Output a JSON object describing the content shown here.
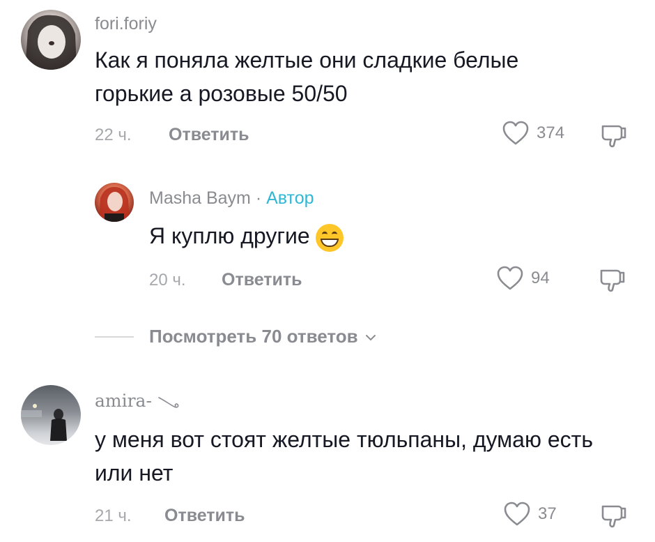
{
  "comments": [
    {
      "username": "fori.foriy",
      "text": "Как я поняла желтые они сладкие белые горькие а розовые 50/50",
      "time": "22 ч.",
      "reply_label": "Ответить",
      "likes": "374"
    },
    {
      "username": "Masha Baym",
      "separator": "·",
      "author_badge": "Автор",
      "text": "Я куплю другие",
      "emoji": "grinning-face-emoji",
      "time": "20 ч.",
      "reply_label": "Ответить",
      "likes": "94"
    },
    {
      "username": "amira-",
      "text": "у меня вот стоят желтые тюльпаны, думаю есть или нет",
      "time": "21 ч.",
      "reply_label": "Ответить",
      "likes": "37"
    }
  ],
  "view_replies": {
    "label": "Посмотреть 70 ответов",
    "icon": "chevron-down-icon"
  },
  "colors": {
    "text": "#161823",
    "secondary": "#8a8b91",
    "author_badge": "#2fb7d6"
  }
}
